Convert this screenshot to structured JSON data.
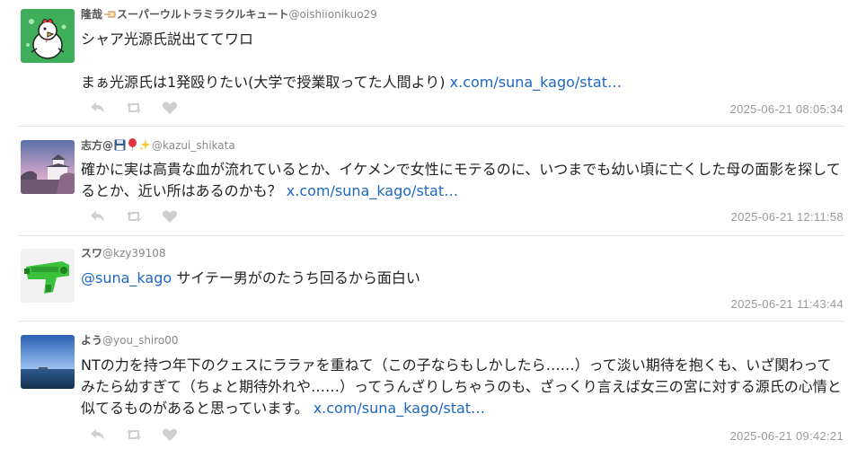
{
  "tweets": [
    {
      "display_name": "隆哉",
      "display_name_suffix": "スーパーウルトラミラクルキュート",
      "handle": "@oishiionikuo29",
      "avatar_icon": "chicken-cartoon-avatar",
      "lines": [
        "シャア光源氏説出ててワロ",
        "",
        "まぁ光源氏は1発殴りたい(大学で授業取ってた人間より) "
      ],
      "link": "x.com/suna_kago/stat…",
      "timestamp": "2025-06-21 08:05:34"
    },
    {
      "display_name": "志方@",
      "handle": "@kazui_shikata",
      "avatar_icon": "castle-at-dusk-avatar",
      "lines": [
        "確かに実は高貴な血が流れているとか、イケメンで女性にモテるのに、いつまでも幼い頃に亡くした母の面影を探してるとか、近い所はあるのかも？ "
      ],
      "link": "x.com/suna_kago/stat…",
      "timestamp": "2025-06-21 12:11:58"
    },
    {
      "display_name": "スワ",
      "handle": "@kzy39108",
      "avatar_icon": "green-water-gun-avatar",
      "mention": "@suna_kago",
      "lines": [
        " サイテー男がのたうち回るから面白い"
      ],
      "timestamp": "2025-06-21 11:43:44"
    },
    {
      "display_name": "よう",
      "handle": "@you_shiro00",
      "avatar_icon": "sea-horizon-avatar",
      "lines": [
        "NTの力を持つ年下のクェスにララァを重ねて（この子ならもしかしたら……）って淡い期待を抱くも、いざ関わってみたら幼すぎて（ちょと期待外れや……）ってうんざりしちゃうのも、ざっくり言えば女三の宮に対する源氏の心情と似てるものがあると思っています。 "
      ],
      "link": "x.com/suna_kago/stat…",
      "timestamp": "2025-06-21 09:42:21"
    }
  ],
  "colors": {
    "link": "#1d67c2",
    "action_icon": "#cfcfcf",
    "timestamp": "#9a9a9a",
    "divider": "#e6e6e6"
  }
}
